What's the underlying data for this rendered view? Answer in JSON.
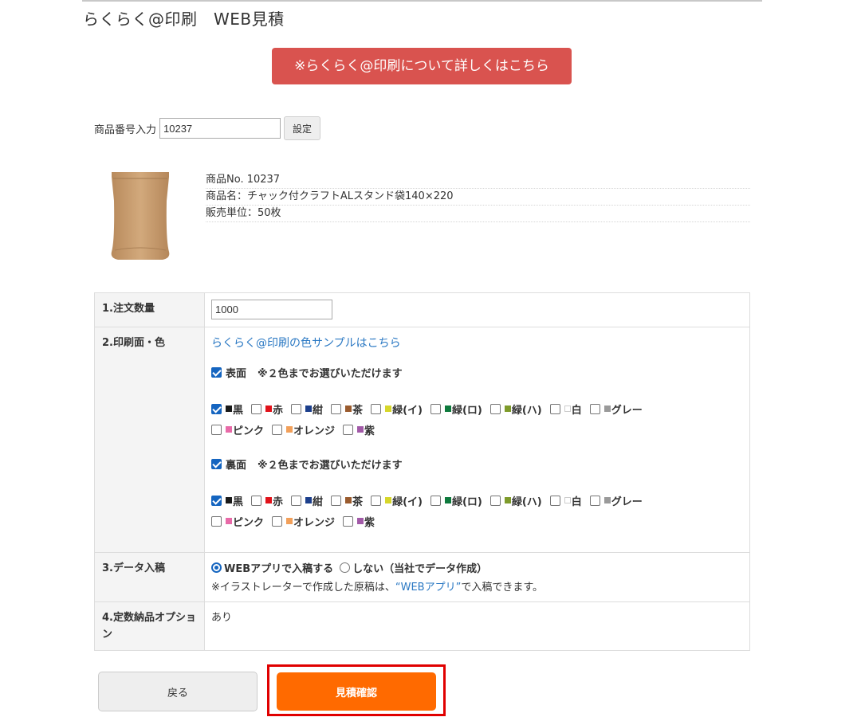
{
  "page": {
    "title": "らくらく@印刷　WEB見積",
    "banner_text": "※らくらく@印刷について詳しくはこちら"
  },
  "product_number": {
    "label": "商品番号入力",
    "value": "10237",
    "set_button": "設定"
  },
  "product": {
    "image_icon": "kraft-stand-pouch-image",
    "number_line": "商品No.  10237",
    "name_line": "商品名：チャック付クラフトALスタンド袋140×220",
    "unit_line": "販売単位：50枚"
  },
  "options": {
    "quantity": {
      "label": "1.注文数量",
      "value": "1000"
    },
    "print": {
      "label": "2.印刷面・色",
      "sample_link": "らくらく@印刷の色サンプルはこちら",
      "front": {
        "label": "表面",
        "note": "※２色までお選びいただけます",
        "checked": true
      },
      "back": {
        "label": "裏面",
        "note": "※２色までお選びいただけます",
        "checked": true
      },
      "colors": [
        {
          "name": "黒",
          "swatch": "#1a1a1a",
          "front_checked": true,
          "back_checked": true
        },
        {
          "name": "赤",
          "swatch": "#e0121a",
          "front_checked": false,
          "back_checked": false
        },
        {
          "name": "紺",
          "swatch": "#1c3f8c",
          "front_checked": false,
          "back_checked": false
        },
        {
          "name": "茶",
          "swatch": "#9a5b2e",
          "front_checked": false,
          "back_checked": false
        },
        {
          "name": "緑(イ)",
          "swatch": "#d6d62a",
          "front_checked": false,
          "back_checked": false
        },
        {
          "name": "緑(ロ)",
          "swatch": "#0e7a3d",
          "front_checked": false,
          "back_checked": false
        },
        {
          "name": "緑(ハ)",
          "swatch": "#7e9b2b",
          "front_checked": false,
          "back_checked": false
        },
        {
          "name": "白",
          "swatch": "#ffffff",
          "front_checked": false,
          "back_checked": false
        },
        {
          "name": "グレー",
          "swatch": "#9a9a9a",
          "front_checked": false,
          "back_checked": false
        },
        {
          "name": "ピンク",
          "swatch": "#e86aa8",
          "front_checked": false,
          "back_checked": false
        },
        {
          "name": "オレンジ",
          "swatch": "#f2a05a",
          "front_checked": false,
          "back_checked": false
        },
        {
          "name": "紫",
          "swatch": "#a25aa8",
          "front_checked": false,
          "back_checked": false
        }
      ]
    },
    "data_submission": {
      "label": "3.データ入稿",
      "option_web": "WEBアプリで入稿する",
      "option_none": "しない（当社でデータ作成）",
      "selected": "web",
      "note_prefix": "※イラストレーターで作成した原稿は、",
      "note_link": "“WEBアプリ”",
      "note_suffix": "で入稿できます。"
    },
    "fixed_delivery": {
      "label": "4.定数納品オプション",
      "value": "あり"
    }
  },
  "actions": {
    "back_label": "戻る",
    "confirm_label": "見積確認"
  },
  "colors": {
    "banner": "#d9534f",
    "confirm": "#ff6a00",
    "highlight": "#e00000",
    "link": "#2a78c3",
    "check": "#1565c0"
  }
}
